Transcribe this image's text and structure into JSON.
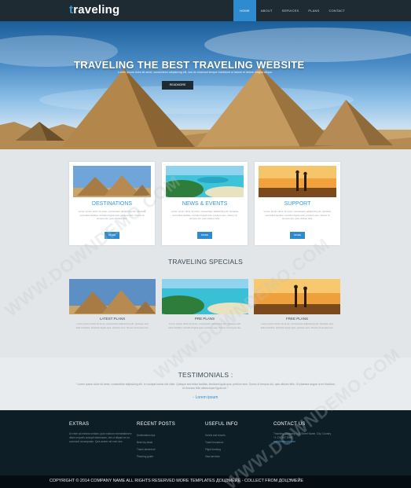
{
  "header": {
    "logo_first": "t",
    "logo_rest": "raveling",
    "nav": [
      "HOME",
      "ABOUT",
      "SERVICES",
      "PLANS",
      "CONTACT"
    ]
  },
  "hero": {
    "title": "TRAVELING THE BEST TRAVELING WEBSITE",
    "subtitle": "Lorem ipsum dolor sit amet, consectetur adipisicing elit, sed do eiusmod tempor incididunt ut labore et dolore magna aliqua.",
    "button": "READMORE"
  },
  "cards": [
    {
      "title": "DESTINATIONS",
      "text": "Lorem ipsum dolor sit amet, consectetur adipisicing elit. Quisque sed tellus facilisis, tincidunt ligula quis, pretium sem. Donec id tempus dui, quis ultrices felis.",
      "button": "MORE"
    },
    {
      "title": "NEWS & EVENTS",
      "text": "Lorem ipsum dolor sit amet, consectetur adipisicing elit. Quisque sed tellus facilisis, tincidunt ligula quis, pretium sem. Donec id tempus dui, quis ultrices felis.",
      "button": "MORE"
    },
    {
      "title": "SUPPORT",
      "text": "Lorem ipsum dolor sit amet, consectetur adipisicing elit. Quisque sed tellus facilisis, tincidunt ligula quis, pretium sem. Donec id tempus dui, quis ultrices felis.",
      "button": "MORE"
    }
  ],
  "specials": {
    "title": "TRAVELING SPECIALS",
    "items": [
      {
        "title": "LATEST PLANS",
        "text": "Lorem ipsum dolor sit amet, consectetur adipisicing elit. Quisque sed tellus facilisis, tincidunt ligula quis, pretium sem. Donec id tempus dui."
      },
      {
        "title": "PRE PLANS",
        "text": "Lorem ipsum dolor sit amet, consectetur adipisicing elit. Quisque sed tellus facilisis, tincidunt ligula quis, pretium sem. Donec id tempus dui."
      },
      {
        "title": "FREE PLANS",
        "text": "Lorem ipsum dolor sit amet, consectetur adipisicing elit. Quisque sed tellus facilisis, tincidunt ligula quis, pretium sem. Donec id tempus dui."
      }
    ]
  },
  "testimonials": {
    "title": "TESTIMONIALS :",
    "quote": "\" Lorem ipsum dolor sit amet, consectetur adipisicing elit. In volutpat luctus nisi vitae. Quisque sed tellus facilisis, tincidunt ligula quis, pretium sem. Donec id tempus dui, quis ultrices felis. Ut pharetra augue ut mi tincidunt, et rhoncus felis ullamcorper ligula vel. \"",
    "author": "- Lorem ipsum"
  },
  "footer": {
    "extras": {
      "title": "EXTRAS",
      "text": "Ut enim ad minima veniam, quis nostrum exercitationem ullam corporis suscipit laboriosam, nisi ut aliquid ex ea commodi consequatur. Quis autem vel eum iure."
    },
    "recent": {
      "title": "RECENT POSTS",
      "links": [
        "Destinations tips",
        "Best trip deals",
        "Travel adventure",
        "Planning guide"
      ]
    },
    "useful": {
      "title": "USEFUL INFO",
      "links": [
        "Hotels and resorts",
        "Travel insurance",
        "Flight booking",
        "Visa services"
      ]
    },
    "contact": {
      "title": "CONTACT US",
      "address": "Traveling Company, 142 Street Name, City, Country",
      "phone": "+1 234 567 8900",
      "email": "mail@example.com"
    }
  },
  "copyright": "COPYRIGHT © 2014 COMPANY NAME ALL RIGHTS RESERVED MORE TEMPLATES ДОЦЭМЕЙЕ - COLLECT FROM ДОЦЭМЕЙЕ",
  "watermark": "WWW.DOWNDEMO.COM"
}
